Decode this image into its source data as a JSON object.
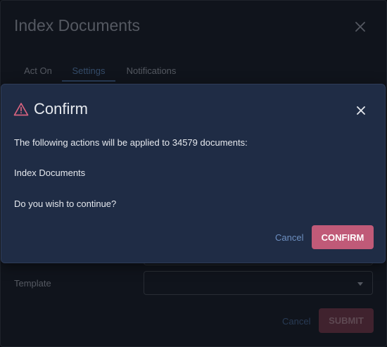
{
  "dialog": {
    "title": "Index Documents",
    "tabs": [
      {
        "label": "Act On"
      },
      {
        "label": "Settings",
        "active": true
      },
      {
        "label": "Notifications"
      }
    ],
    "template_label": "Template",
    "template_value": "",
    "cancel_label": "Cancel",
    "submit_label": "SUBMIT"
  },
  "modal": {
    "title": "Confirm",
    "message_line1": "The following actions will be applied to 34579 documents:",
    "message_line2": "Index Documents",
    "message_line3": "Do you wish to continue?",
    "cancel_label": "Cancel",
    "confirm_label": "CONFIRM"
  },
  "icons": {
    "dialog_close": "close-icon",
    "modal_close": "close-icon",
    "warning": "warning-triangle-icon",
    "select_caret": "caret-down-icon"
  },
  "colors": {
    "background": "#151a22",
    "modal_background": "#1f2c45",
    "accent": "#c05a78",
    "link": "#6d8fc0",
    "warning": "#d9637f"
  }
}
